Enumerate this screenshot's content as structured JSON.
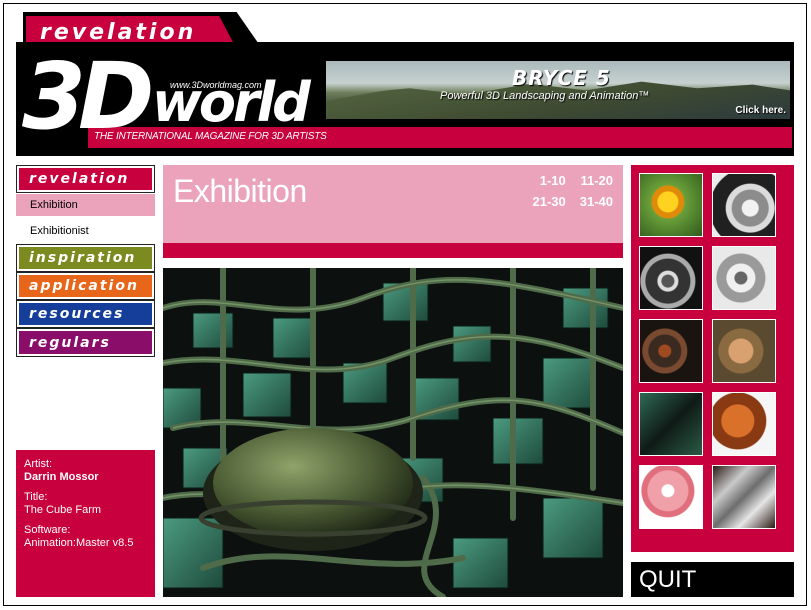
{
  "header": {
    "section_tab": "revelation",
    "logo_3d": "3D",
    "logo_world": "world",
    "logo_url": "www.3Dworldmag.com",
    "tagline": "THE INTERNATIONAL MAGAZINE FOR 3D ARTISTS"
  },
  "ad": {
    "title": "BRYCE 5",
    "subtitle": "Powerful 3D Landscaping and Animation™",
    "cta": "Click here."
  },
  "nav": {
    "revelation": "revelation",
    "exhibition": "Exhibition",
    "exhibitionist": "Exhibitionist",
    "inspiration": "inspiration",
    "application": "application",
    "resources": "resources",
    "regulars": "regulars"
  },
  "colors": {
    "revelation": "#c8003d",
    "inspiration": "#7b8b1f",
    "application": "#e8661a",
    "resources": "#143e9a",
    "regulars": "#8a0d6a",
    "pink": "#eba3bc",
    "accent": "#c8003d"
  },
  "page": {
    "title": "Exhibition",
    "ranges": [
      "1-10",
      "11-20",
      "21-30",
      "31-40"
    ]
  },
  "artist": {
    "artist_label": "Artist:",
    "artist_name": "Darrin Mossor",
    "title_label": "Title:",
    "title_value": "The Cube Farm",
    "software_label": "Software:",
    "software_value": "Animation:Master v8.5"
  },
  "thumbnails": [
    "flower-thumbnail",
    "motorcycle-engine-thumbnail",
    "motorcycle-wheel-thumbnail",
    "chrome-wheel-thumbnail",
    "steampunk-gear-thumbnail",
    "creature-face-thumbnail",
    "cube-farm-thumbnail",
    "orange-creature-thumbnail",
    "cartoon-fish-thumbnail",
    "chain-link-thumbnail"
  ],
  "quit_label": "QUIT"
}
